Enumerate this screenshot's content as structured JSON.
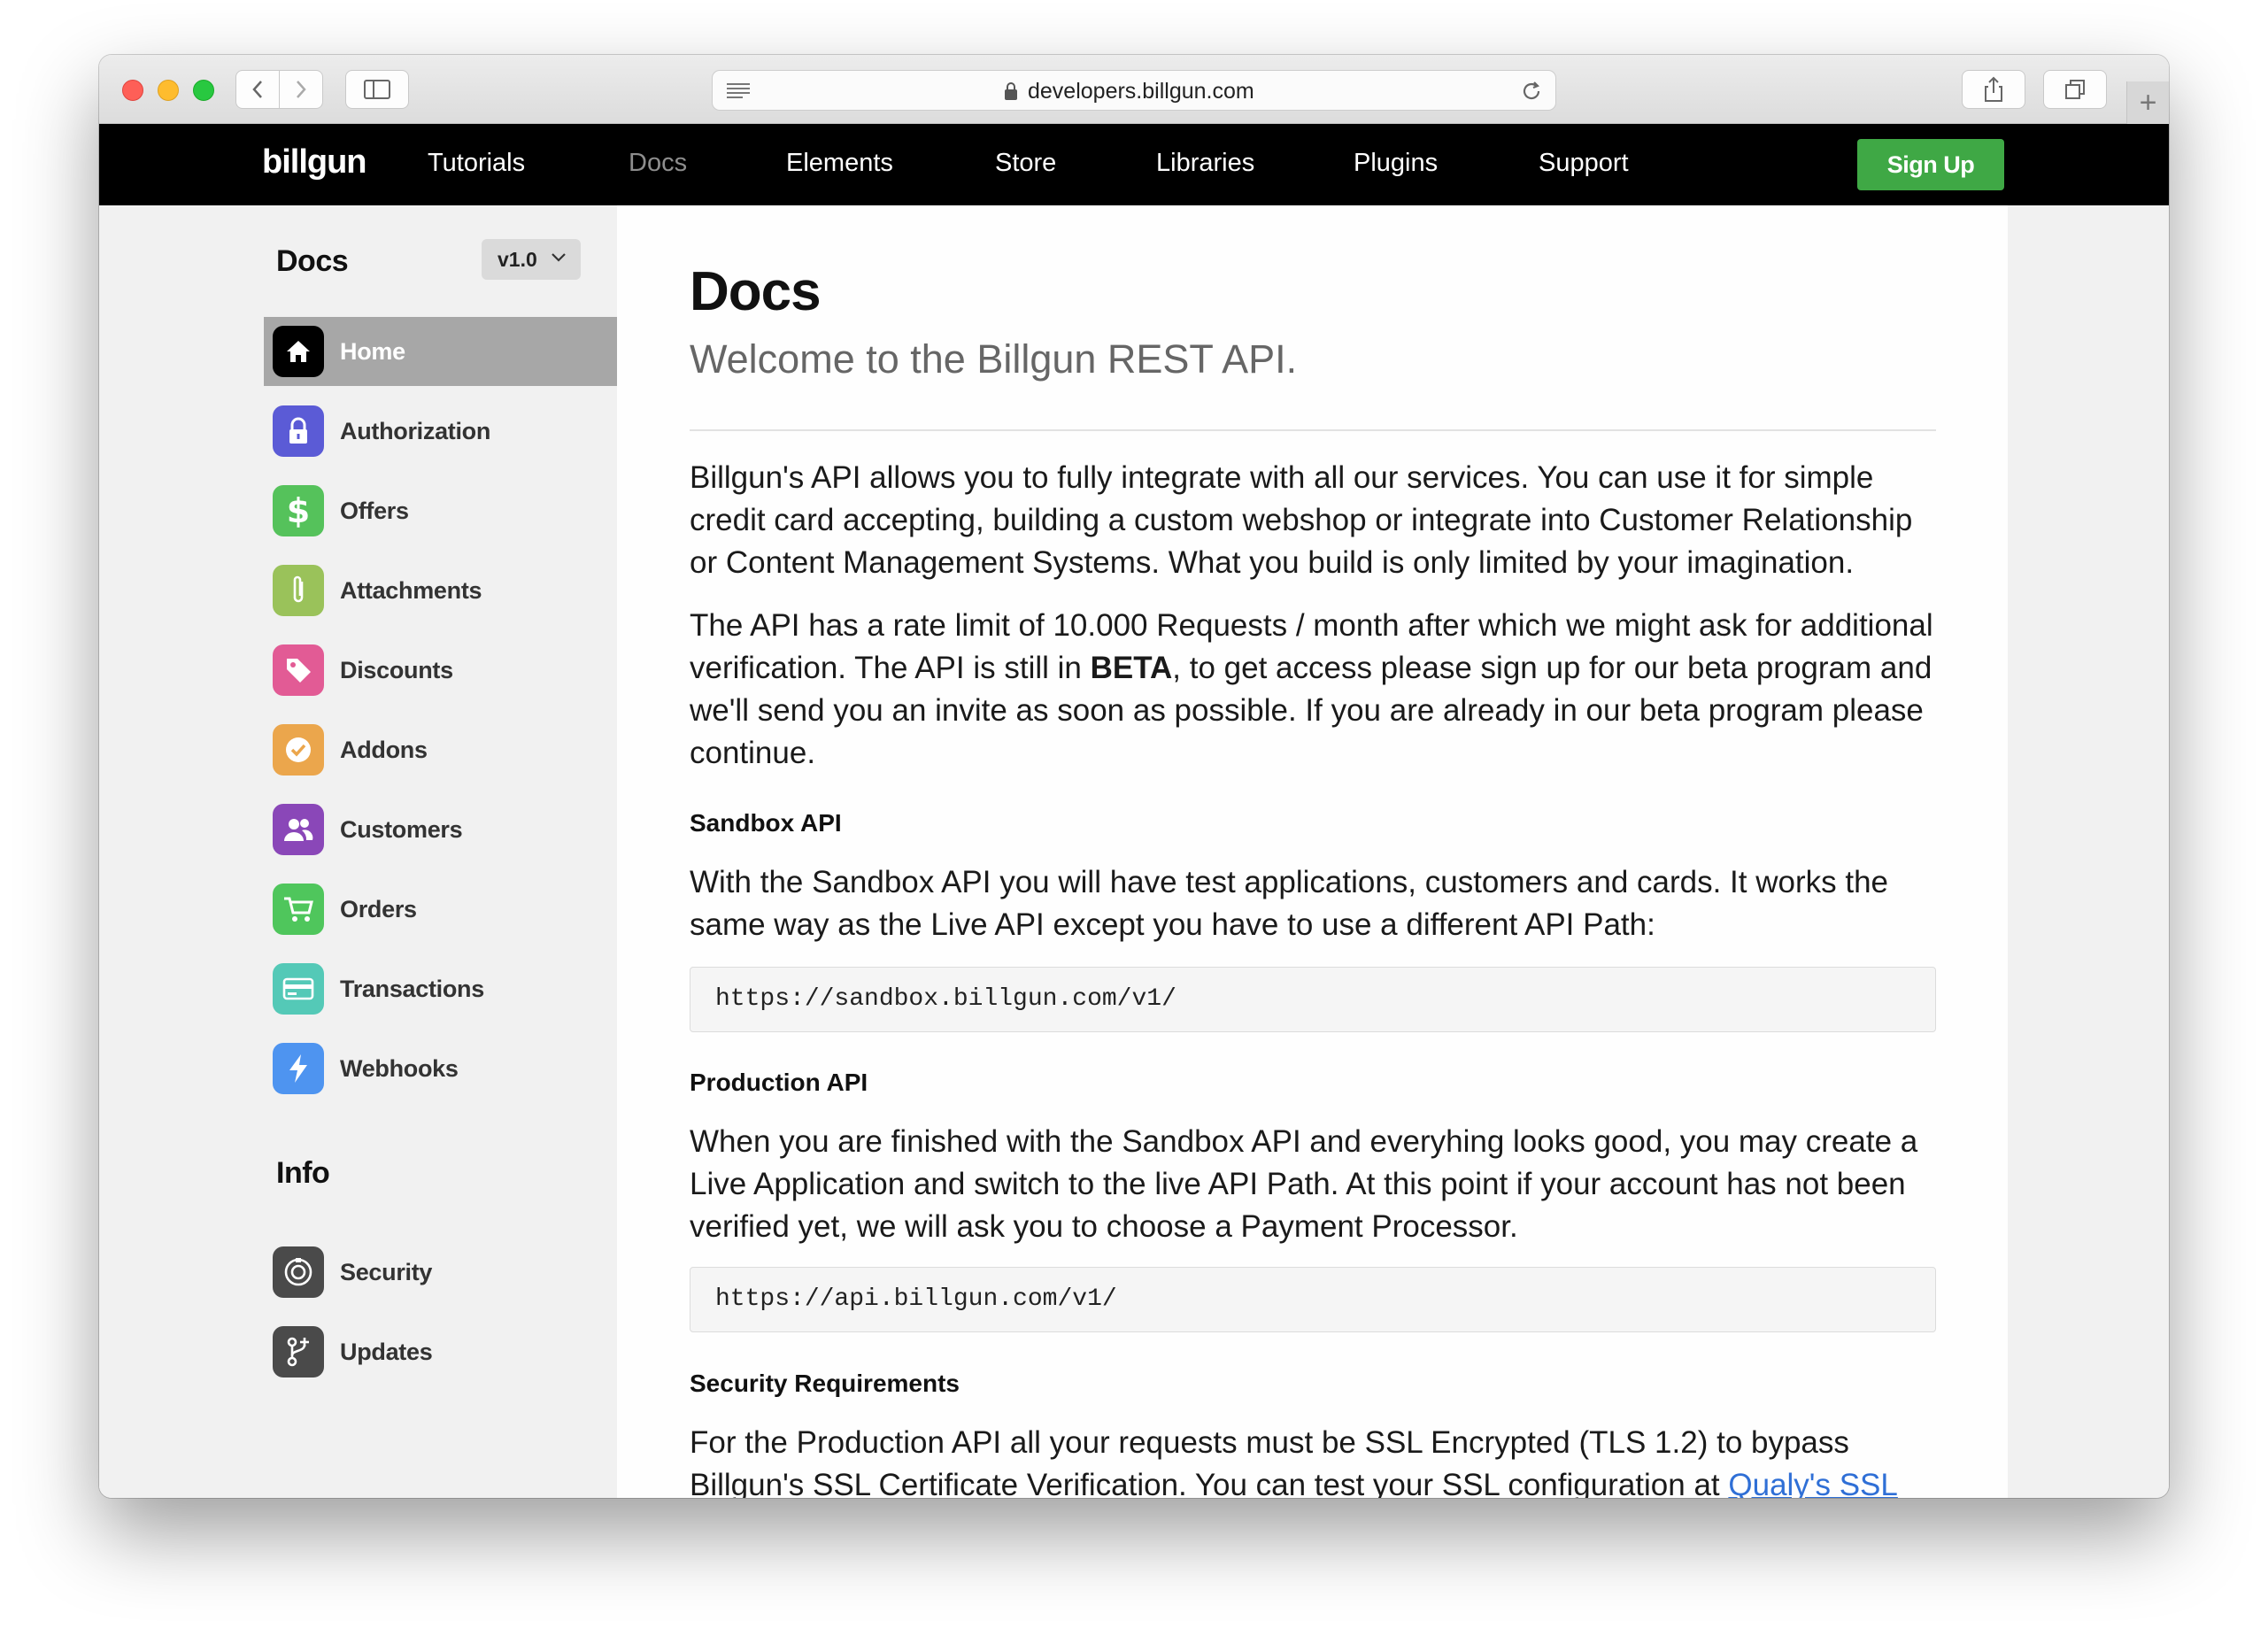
{
  "browser": {
    "url": "developers.billgun.com"
  },
  "nav": {
    "logo": "billgun",
    "links": [
      "Tutorials",
      "Docs",
      "Elements",
      "Store",
      "Libraries",
      "Plugins",
      "Support"
    ],
    "active": "Docs",
    "signup_label": "Sign Up",
    "signup_color": "#3fa845"
  },
  "sidebar": {
    "docs_title": "Docs",
    "version": "v1.0",
    "items": [
      {
        "label": "Home",
        "icon": "home-icon",
        "color": "#000000"
      },
      {
        "label": "Authorization",
        "icon": "lock-icon",
        "color": "#5b5bd6"
      },
      {
        "label": "Offers",
        "icon": "dollar-icon",
        "color": "#55c25b"
      },
      {
        "label": "Attachments",
        "icon": "paperclip-icon",
        "color": "#9ac25a"
      },
      {
        "label": "Discounts",
        "icon": "tag-icon",
        "color": "#e25b95"
      },
      {
        "label": "Addons",
        "icon": "check-circle-icon",
        "color": "#eba64c"
      },
      {
        "label": "Customers",
        "icon": "users-icon",
        "color": "#8a47b8"
      },
      {
        "label": "Orders",
        "icon": "cart-icon",
        "color": "#4fc65c"
      },
      {
        "label": "Transactions",
        "icon": "credit-card-icon",
        "color": "#54c9b7"
      },
      {
        "label": "Webhooks",
        "icon": "bolt-icon",
        "color": "#4e94f0"
      }
    ],
    "info_title": "Info",
    "info_items": [
      {
        "label": "Security",
        "icon": "safe-icon",
        "color": "#4a4a4a"
      },
      {
        "label": "Updates",
        "icon": "branch-icon",
        "color": "#4a4a4a"
      }
    ]
  },
  "main": {
    "title": "Docs",
    "subtitle": "Welcome to the Billgun REST API.",
    "intro": [
      "Billgun's API allows you to fully integrate with all our services. You can use it for simple",
      "credit card accepting, building a custom webshop or integrate into Customer Relationship",
      "or Content Management Systems. What you build is only limited by your imagination."
    ],
    "rate": {
      "line1": "The API has a rate limit of 10.000 Requests / month after which we might ask for additional",
      "line2_pre": "verification. The API is still in ",
      "line2_bold": "BETA",
      "line2_post": ", to get access please sign up for our beta program and",
      "line3": "we'll send you an invite as soon as possible. If you are already in our beta program please",
      "line4": "continue."
    },
    "sandbox": {
      "heading": "Sandbox API",
      "text": [
        "With the Sandbox API you will have test applications, customers and cards. It works the",
        "same way as the Live API except you have to use a different API Path:"
      ],
      "code": "https://sandbox.billgun.com/v1/"
    },
    "production": {
      "heading": "Production API",
      "text": [
        "When you are finished with the Sandbox API and everyhing looks good, you may create a",
        "Live Application and switch to the live API Path. At this point if your account has not been",
        "verified yet, we will ask you to choose a Payment Processor."
      ],
      "code": "https://api.billgun.com/v1/"
    },
    "security": {
      "heading": "Security Requirements",
      "line1": "For the Production API all your requests must be SSL Encrypted (TLS 1.2) to bypass",
      "line2_pre": "Billgun's SSL Certificate Verification. You can test your SSL configuration at ",
      "line2_link": "Qualy's SSL"
    }
  }
}
